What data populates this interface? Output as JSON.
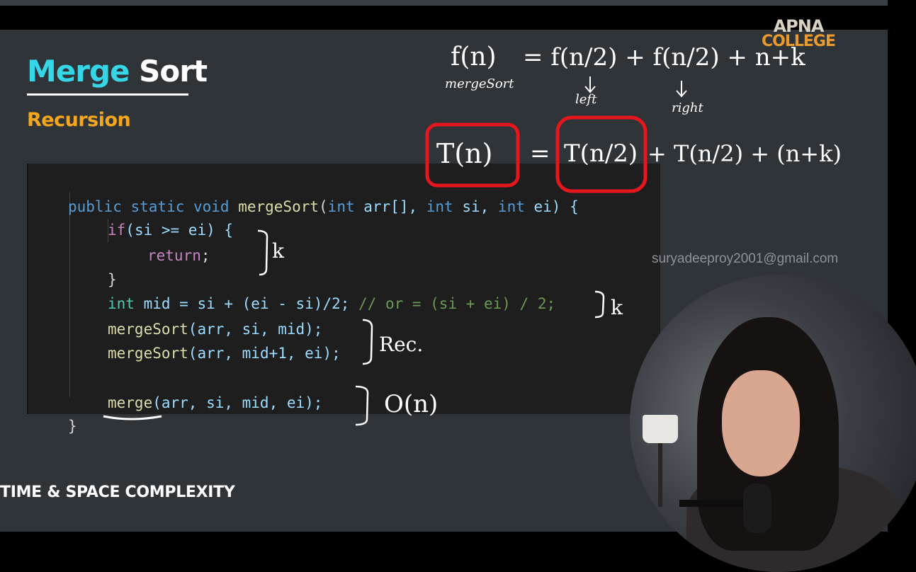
{
  "slide": {
    "title_part1": "Merge",
    "title_part2": "Sort",
    "subtitle": "Recursion",
    "footer_label": "TIME & SPACE COMPLEXITY",
    "watermark_email": "suryadeeproy2001@gmail.com",
    "logo": {
      "line1": "APNA",
      "line2": "COLLEGE"
    }
  },
  "code": {
    "l1": {
      "t1": "public static void ",
      "t2": "mergeSort",
      "t3": "(",
      "t4": "int",
      "t5": " arr[], ",
      "t6": "int",
      "t7": " si, ",
      "t8": "int",
      "t9": " ei) {"
    },
    "l2": {
      "t1": "if",
      "t2": "(si >= ei) {"
    },
    "l3": {
      "t1": "return",
      "t2": ";"
    },
    "l4": {
      "t1": "}"
    },
    "l5": {
      "t1": "int",
      "t2": " mid = si + (ei - si)/2; ",
      "t3": "// or = (si + ei) / 2;"
    },
    "l6": {
      "t1": "mergeSort",
      "t2": "(arr, si, mid);"
    },
    "l7": {
      "t1": "mergeSort",
      "t2": "(arr, mid+1, ei);"
    },
    "l8": {
      "t1": "merge",
      "t2": "(arr, si, mid, ei);"
    },
    "l9": {
      "t1": "}"
    }
  },
  "handwriting": {
    "eq1_lhs": "f(n)",
    "eq1_rhs": "=  f(n/2)  + f(n/2)  + n+k",
    "eq1_lhs_note": "mergeSort",
    "eq1_left_note": "left",
    "eq1_right_note": "right",
    "eq2_lhs": "T(n)",
    "eq2_eq": "=",
    "eq2_t1": "T(n/2)",
    "eq2_rest": "+ T(n/2)  + (n+k)",
    "note_k1": "k",
    "note_k2": "k",
    "note_rec": "Rec.",
    "note_on": "O(n)"
  },
  "colors": {
    "slide_bg": "#2f3438",
    "code_bg": "#1e1e1f",
    "title_accent": "#35d6e7",
    "subtitle": "#f4a61d",
    "highlight_box": "#e5161d"
  }
}
